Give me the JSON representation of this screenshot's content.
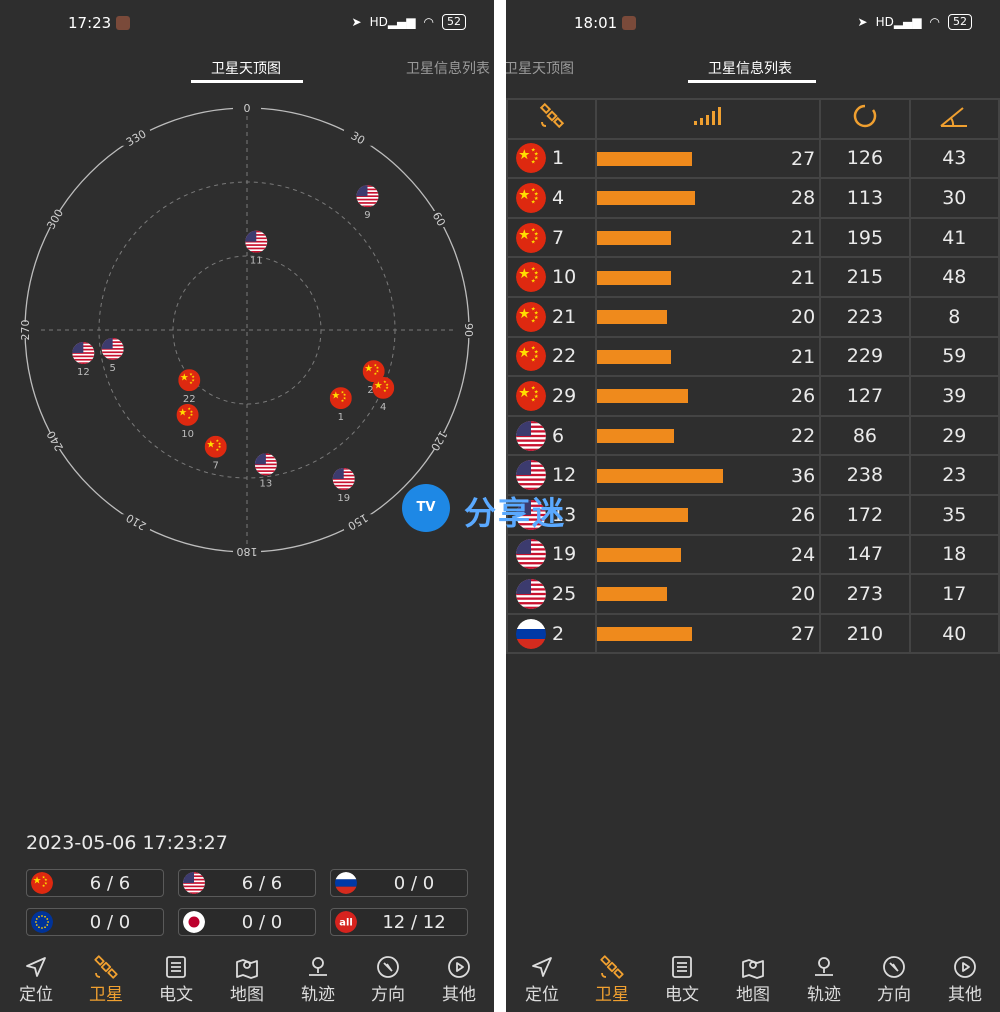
{
  "left": {
    "status": {
      "time": "17:23",
      "battery": "52",
      "hd": "HD"
    },
    "tabs": {
      "active": "卫星天顶图",
      "inactive": "卫星信息列表"
    },
    "skyplot": {
      "degree_labels": [
        {
          "label": "0",
          "deg": 0
        },
        {
          "label": "30",
          "deg": 30
        },
        {
          "label": "60",
          "deg": 60
        },
        {
          "label": "90",
          "deg": 90
        },
        {
          "label": "120",
          "deg": 120
        },
        {
          "label": "150",
          "deg": 150
        },
        {
          "label": "180",
          "deg": 180
        },
        {
          "label": "210",
          "deg": 210
        },
        {
          "label": "240",
          "deg": 240
        },
        {
          "label": "270",
          "deg": 270
        },
        {
          "label": "300",
          "deg": 300
        },
        {
          "label": "330",
          "deg": 330
        }
      ],
      "satellites": [
        {
          "prn": "9",
          "flag": "us",
          "azimuth": 42,
          "elevation": 17
        },
        {
          "prn": "11",
          "flag": "us",
          "azimuth": 6,
          "elevation": 54
        },
        {
          "prn": "5",
          "flag": "us",
          "azimuth": 262,
          "elevation": 35
        },
        {
          "prn": "12",
          "flag": "us",
          "azimuth": 262,
          "elevation": 23
        },
        {
          "prn": "29",
          "flag": "cn",
          "azimuth": 108,
          "elevation": 36
        },
        {
          "prn": "4",
          "flag": "cn",
          "azimuth": 113,
          "elevation": 30
        },
        {
          "prn": "1",
          "flag": "cn",
          "azimuth": 126,
          "elevation": 43
        },
        {
          "prn": "10",
          "flag": "cn",
          "azimuth": 215,
          "elevation": 48
        },
        {
          "prn": "22",
          "flag": "cn",
          "azimuth": 229,
          "elevation": 59
        },
        {
          "prn": "7",
          "flag": "cn",
          "azimuth": 195,
          "elevation": 41
        },
        {
          "prn": "19",
          "flag": "us",
          "azimuth": 147,
          "elevation": 18
        },
        {
          "prn": "13",
          "flag": "us",
          "azimuth": 172,
          "elevation": 35
        }
      ]
    },
    "date": "2023-05-06  17:23:27",
    "counts": [
      {
        "flag": "cn",
        "value": "6 / 6"
      },
      {
        "flag": "us",
        "value": "6 / 6"
      },
      {
        "flag": "ru",
        "value": "0 / 0"
      },
      {
        "flag": "eu",
        "value": "0 / 0"
      },
      {
        "flag": "jp",
        "value": "0 / 0"
      },
      {
        "flag": "all",
        "value": "12 / 12",
        "all_label": "all"
      }
    ]
  },
  "right": {
    "status": {
      "time": "18:01",
      "battery": "52",
      "hd": "HD"
    },
    "tabs": {
      "inactive": "卫星天顶图",
      "active": "卫星信息列表"
    },
    "table": {
      "header_icons": [
        "satellite-icon",
        "signal-bars-icon",
        "azimuth-icon",
        "elevation-icon"
      ],
      "snr_max": 50,
      "rows": [
        {
          "flag": "cn",
          "prn": "1",
          "snr": "27",
          "azimuth": "126",
          "elevation": "43"
        },
        {
          "flag": "cn",
          "prn": "4",
          "snr": "28",
          "azimuth": "113",
          "elevation": "30"
        },
        {
          "flag": "cn",
          "prn": "7",
          "snr": "21",
          "azimuth": "195",
          "elevation": "41"
        },
        {
          "flag": "cn",
          "prn": "10",
          "snr": "21",
          "azimuth": "215",
          "elevation": "48"
        },
        {
          "flag": "cn",
          "prn": "21",
          "snr": "20",
          "azimuth": "223",
          "elevation": "8"
        },
        {
          "flag": "cn",
          "prn": "22",
          "snr": "21",
          "azimuth": "229",
          "elevation": "59"
        },
        {
          "flag": "cn",
          "prn": "29",
          "snr": "26",
          "azimuth": "127",
          "elevation": "39"
        },
        {
          "flag": "us",
          "prn": "6",
          "snr": "22",
          "azimuth": "86",
          "elevation": "29"
        },
        {
          "flag": "us",
          "prn": "12",
          "snr": "36",
          "azimuth": "238",
          "elevation": "23"
        },
        {
          "flag": "us",
          "prn": "13",
          "snr": "26",
          "azimuth": "172",
          "elevation": "35"
        },
        {
          "flag": "us",
          "prn": "19",
          "snr": "24",
          "azimuth": "147",
          "elevation": "18"
        },
        {
          "flag": "us",
          "prn": "25",
          "snr": "20",
          "azimuth": "273",
          "elevation": "17"
        },
        {
          "flag": "ru",
          "prn": "2",
          "snr": "27",
          "azimuth": "210",
          "elevation": "40"
        }
      ]
    }
  },
  "nav": {
    "active_index": 1,
    "items": [
      {
        "label": "定位",
        "icon": "navigation-arrow-icon"
      },
      {
        "label": "卫星",
        "icon": "satellite-icon"
      },
      {
        "label": "电文",
        "icon": "document-icon"
      },
      {
        "label": "地图",
        "icon": "map-icon"
      },
      {
        "label": "轨迹",
        "icon": "track-pin-icon"
      },
      {
        "label": "方向",
        "icon": "compass-icon"
      },
      {
        "label": "其他",
        "icon": "play-circle-icon"
      }
    ]
  },
  "watermark": {
    "badge": "TV",
    "text": "分享迷"
  },
  "colors": {
    "background": "#2e2e2e",
    "accent": "#f0a030",
    "bar": "#ef8a1c",
    "china_red": "#de2910",
    "china_yellow": "#ffde00"
  }
}
